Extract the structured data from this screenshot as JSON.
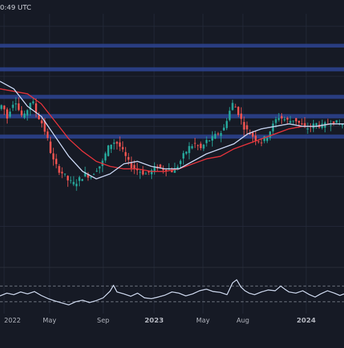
{
  "header": {
    "timestamp_text": "0:49 UTC"
  },
  "colors": {
    "background": "#161a25",
    "zone_fill": "#2a3f86",
    "up": "#26a69a",
    "down": "#ef5350",
    "ma_fast": "#c9d6f2",
    "ma_slow": "#e5333b",
    "grid": "#232838",
    "osc_line": "#d6e1f7",
    "osc_dash": "#7a7f8b",
    "axis_text": "#b2b5be"
  },
  "chart_data": {
    "type": "candlestick",
    "title": "",
    "x_axis": {
      "tick_labels": [
        "2022",
        "May",
        "Sep",
        "2023",
        "May",
        "Aug",
        "2024"
      ],
      "bold_ticks": [
        "2023",
        "2024"
      ]
    },
    "price_range": [
      0,
      100
    ],
    "price_scale": "log",
    "zones": [
      {
        "low": 86.5,
        "high": 88.0
      },
      {
        "low": 77.0,
        "high": 78.6
      },
      {
        "low": 66.0,
        "high": 67.6
      },
      {
        "low": 58.2,
        "high": 59.9
      },
      {
        "low": 50.1,
        "high": 51.7
      }
    ],
    "main_series": [
      {
        "name": "",
        "role": "price",
        "points": [
          [
            0,
            62
          ],
          [
            6,
            64
          ],
          [
            12,
            58
          ],
          [
            18,
            63
          ],
          [
            24,
            66
          ],
          [
            30,
            61
          ],
          [
            36,
            58
          ],
          [
            42,
            62
          ],
          [
            48,
            66
          ],
          [
            55,
            60
          ],
          [
            62,
            57
          ],
          [
            70,
            51
          ],
          [
            78,
            42
          ],
          [
            86,
            38
          ],
          [
            94,
            36
          ],
          [
            102,
            33
          ],
          [
            110,
            32
          ],
          [
            118,
            34
          ],
          [
            126,
            36
          ],
          [
            134,
            35
          ],
          [
            142,
            38
          ],
          [
            150,
            40
          ],
          [
            158,
            46
          ],
          [
            166,
            49
          ],
          [
            174,
            48
          ],
          [
            182,
            44
          ],
          [
            190,
            40
          ],
          [
            198,
            38
          ],
          [
            206,
            37
          ],
          [
            214,
            36
          ],
          [
            222,
            37
          ],
          [
            230,
            39
          ],
          [
            238,
            38
          ],
          [
            246,
            38
          ],
          [
            254,
            37
          ],
          [
            262,
            40
          ],
          [
            270,
            44
          ],
          [
            278,
            47
          ],
          [
            286,
            48
          ],
          [
            294,
            46
          ],
          [
            302,
            49
          ],
          [
            310,
            50
          ],
          [
            318,
            52
          ],
          [
            326,
            53
          ],
          [
            334,
            60
          ],
          [
            340,
            64
          ],
          [
            346,
            62
          ],
          [
            352,
            58
          ],
          [
            358,
            54
          ],
          [
            366,
            52
          ],
          [
            374,
            50
          ],
          [
            382,
            49
          ],
          [
            390,
            51
          ],
          [
            398,
            55
          ],
          [
            406,
            59
          ],
          [
            414,
            58
          ],
          [
            422,
            57
          ],
          [
            430,
            58
          ],
          [
            438,
            56
          ],
          [
            446,
            54
          ],
          [
            454,
            55
          ],
          [
            462,
            56
          ],
          [
            470,
            55
          ],
          [
            478,
            56
          ],
          [
            486,
            57
          ],
          [
            494,
            56
          ],
          [
            500,
            56
          ]
        ]
      },
      {
        "name": "",
        "role": "ma_fast",
        "points": [
          [
            0,
            73
          ],
          [
            20,
            70
          ],
          [
            40,
            63
          ],
          [
            60,
            59
          ],
          [
            80,
            51
          ],
          [
            100,
            43
          ],
          [
            120,
            37
          ],
          [
            140,
            34
          ],
          [
            160,
            36
          ],
          [
            180,
            40
          ],
          [
            200,
            41
          ],
          [
            220,
            39
          ],
          [
            240,
            38
          ],
          [
            260,
            38
          ],
          [
            280,
            41
          ],
          [
            300,
            44
          ],
          [
            320,
            46
          ],
          [
            340,
            48
          ],
          [
            360,
            52
          ],
          [
            380,
            54
          ],
          [
            400,
            55
          ],
          [
            420,
            56
          ],
          [
            440,
            55
          ],
          [
            460,
            55
          ],
          [
            480,
            56
          ],
          [
            500,
            56
          ]
        ]
      },
      {
        "name": "",
        "role": "ma_slow",
        "points": [
          [
            0,
            70
          ],
          [
            20,
            69
          ],
          [
            40,
            68
          ],
          [
            60,
            64
          ],
          [
            80,
            57
          ],
          [
            100,
            50
          ],
          [
            120,
            45
          ],
          [
            140,
            41
          ],
          [
            160,
            39
          ],
          [
            180,
            38
          ],
          [
            200,
            38
          ],
          [
            220,
            37
          ],
          [
            240,
            37
          ],
          [
            260,
            38
          ],
          [
            280,
            40
          ],
          [
            300,
            42
          ],
          [
            320,
            43
          ],
          [
            340,
            46
          ],
          [
            360,
            48
          ],
          [
            380,
            50
          ],
          [
            400,
            52
          ],
          [
            420,
            54
          ],
          [
            440,
            55
          ],
          [
            460,
            55
          ],
          [
            480,
            56
          ],
          [
            500,
            56
          ]
        ]
      }
    ],
    "oscillator": {
      "range": [
        0,
        100
      ],
      "levels": [
        70,
        30
      ],
      "points": [
        [
          0,
          45
        ],
        [
          10,
          52
        ],
        [
          20,
          48
        ],
        [
          30,
          55
        ],
        [
          40,
          50
        ],
        [
          50,
          56
        ],
        [
          60,
          46
        ],
        [
          70,
          38
        ],
        [
          80,
          32
        ],
        [
          90,
          27
        ],
        [
          100,
          22
        ],
        [
          110,
          30
        ],
        [
          120,
          34
        ],
        [
          130,
          28
        ],
        [
          140,
          33
        ],
        [
          150,
          40
        ],
        [
          160,
          57
        ],
        [
          165,
          72
        ],
        [
          170,
          55
        ],
        [
          180,
          50
        ],
        [
          190,
          44
        ],
        [
          200,
          52
        ],
        [
          210,
          40
        ],
        [
          220,
          38
        ],
        [
          230,
          42
        ],
        [
          240,
          47
        ],
        [
          250,
          55
        ],
        [
          260,
          52
        ],
        [
          270,
          45
        ],
        [
          280,
          50
        ],
        [
          290,
          58
        ],
        [
          300,
          62
        ],
        [
          310,
          56
        ],
        [
          320,
          54
        ],
        [
          330,
          48
        ],
        [
          338,
          78
        ],
        [
          344,
          86
        ],
        [
          350,
          68
        ],
        [
          356,
          58
        ],
        [
          362,
          52
        ],
        [
          370,
          48
        ],
        [
          380,
          55
        ],
        [
          390,
          60
        ],
        [
          400,
          58
        ],
        [
          408,
          70
        ],
        [
          414,
          62
        ],
        [
          420,
          55
        ],
        [
          430,
          52
        ],
        [
          440,
          58
        ],
        [
          450,
          48
        ],
        [
          458,
          42
        ],
        [
          466,
          50
        ],
        [
          476,
          58
        ],
        [
          486,
          52
        ],
        [
          494,
          46
        ],
        [
          500,
          50
        ]
      ]
    }
  }
}
